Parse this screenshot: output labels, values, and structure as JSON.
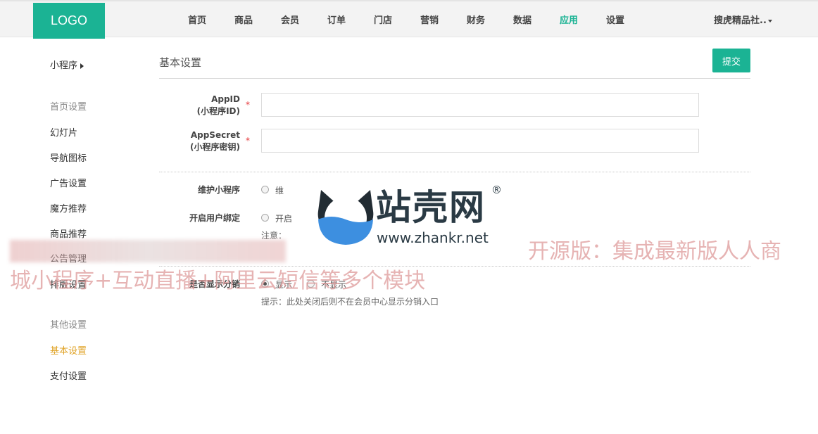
{
  "header": {
    "logo": "LOGO",
    "nav": [
      {
        "label": "首页"
      },
      {
        "label": "商品"
      },
      {
        "label": "会员"
      },
      {
        "label": "订单"
      },
      {
        "label": "门店"
      },
      {
        "label": "营销"
      },
      {
        "label": "财务"
      },
      {
        "label": "数据"
      },
      {
        "label": "应用",
        "active": true
      },
      {
        "label": "设置"
      }
    ],
    "user_menu": "搜虎精品社.."
  },
  "sidebar": {
    "title": "小程序",
    "groups": [
      {
        "label": "首页设置",
        "items": [
          "幻灯片",
          "导航图标",
          "广告设置",
          "魔方推荐",
          "商品推荐",
          "公告管理",
          "排版设置"
        ]
      },
      {
        "label": "其他设置",
        "items": [
          "基本设置",
          "支付设置"
        ]
      }
    ],
    "active_item": "基本设置"
  },
  "main": {
    "section_title": "基本设置",
    "submit_label": "提交",
    "fields": {
      "appid": {
        "label_line1": "AppID",
        "label_line2": "(小程序ID)",
        "required_mark": "*",
        "value": ""
      },
      "appsecret": {
        "label_line1": "AppSecret",
        "label_line2": "(小程序密钥)",
        "required_mark": "*",
        "value": ""
      }
    },
    "maintain": {
      "label": "维护小程序",
      "option_visible": "维"
    },
    "user_bind": {
      "label": "开启用户绑定",
      "option_visible": "开启",
      "note": "注意："
    },
    "distribution": {
      "label": "是否显示分销",
      "options": [
        "显示",
        "不显示"
      ],
      "selected": "显示",
      "hint": "提示：此处关闭后则不在会员中心显示分销入口"
    }
  },
  "watermark": {
    "brand": "站壳网",
    "registered": "®",
    "url": "www.zhankr.net",
    "banner_line1": "开源版：集成最新版人人商",
    "banner_line2": "城小程序+互动直播+阿里云短信等多个模块"
  },
  "colors": {
    "accent": "#1bb394",
    "active_sidebar": "#e0a326",
    "required": "#e4393c"
  }
}
